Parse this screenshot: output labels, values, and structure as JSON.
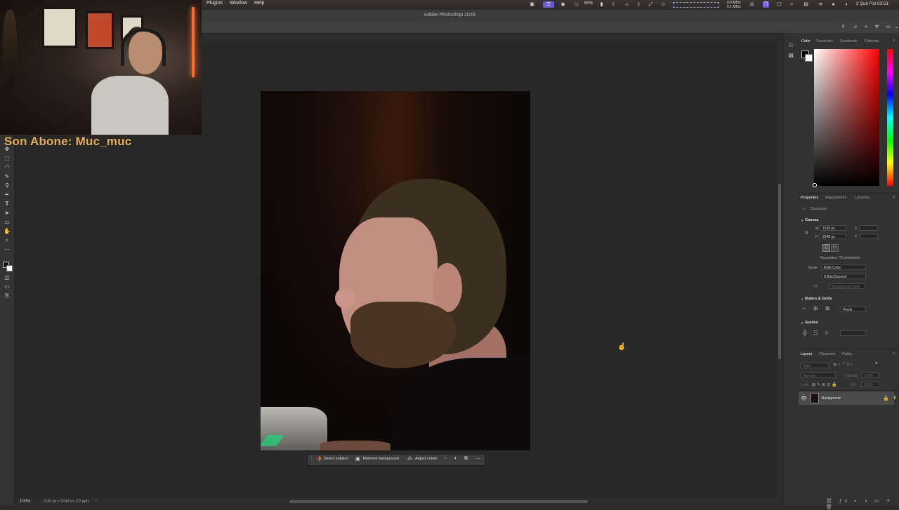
{
  "menubar": {
    "items": [
      "Plugins",
      "Window",
      "Help"
    ],
    "battery": "80%",
    "net_up": "0.0 MB/s",
    "net_down": "0.1 MB/s",
    "date_time": "2 Şub Pzt  03:51"
  },
  "app": {
    "title": "Adobe Photoshop 2026"
  },
  "overlay": {
    "subscriber_text": "Son Abone: Muc_muc"
  },
  "status": {
    "zoom": "100%",
    "doc_info": "1536 px x 2048 px (72 ppi)"
  },
  "contextual_taskbar": {
    "select_subject": "Select subject",
    "remove_background": "Remove background",
    "adjust_colors": "Adjust colors"
  },
  "color_panel": {
    "tabs": [
      "Color",
      "Swatches",
      "Gradients",
      "Patterns"
    ],
    "active": "Color"
  },
  "properties_panel": {
    "tabs": [
      "Properties",
      "Adjustments",
      "Libraries"
    ],
    "doc_label": "Document",
    "canvas_header": "Canvas",
    "w_label": "W",
    "w_value": "1536 px",
    "h_label": "H",
    "h_value": "2048 px",
    "x_label": "X",
    "y_label": "Y",
    "resolution": "Resolution: 72 pixels/inch",
    "mode_label": "Mode",
    "mode_value": "RGB Color",
    "bits_value": "8 Bits/Channel",
    "fill_label": "Fill",
    "fill_value": "Background Color",
    "rulers_header": "Rulers & Grids",
    "rulers_unit": "Pixels",
    "guides_header": "Guides"
  },
  "layers_panel": {
    "tabs": [
      "Layers",
      "Channels",
      "Paths"
    ],
    "kind_label": "Kind",
    "blend_mode": "Normal",
    "opacity_label": "Opacity:",
    "opacity_value": "100%",
    "lock_label": "Lock:",
    "fill_label": "Fill:",
    "fill_value": "100%",
    "layer_name": "Background"
  },
  "icons": {
    "tools": [
      "move-tool-icon",
      "marquee-tool-icon",
      "lasso-tool-icon",
      "brush-tool-icon",
      "stamp-tool-icon",
      "pen-tool-icon",
      "type-tool-icon",
      "path-select-tool-icon",
      "rectangle-tool-icon",
      "hand-tool-icon",
      "zoom-tool-icon",
      "more-tools-icon"
    ],
    "tool_glyphs": [
      "✥",
      "⬚",
      "◠",
      "✎",
      "⚲",
      "✒",
      "T",
      "➤",
      "▭",
      "✋",
      "⌕",
      "⋯"
    ]
  }
}
